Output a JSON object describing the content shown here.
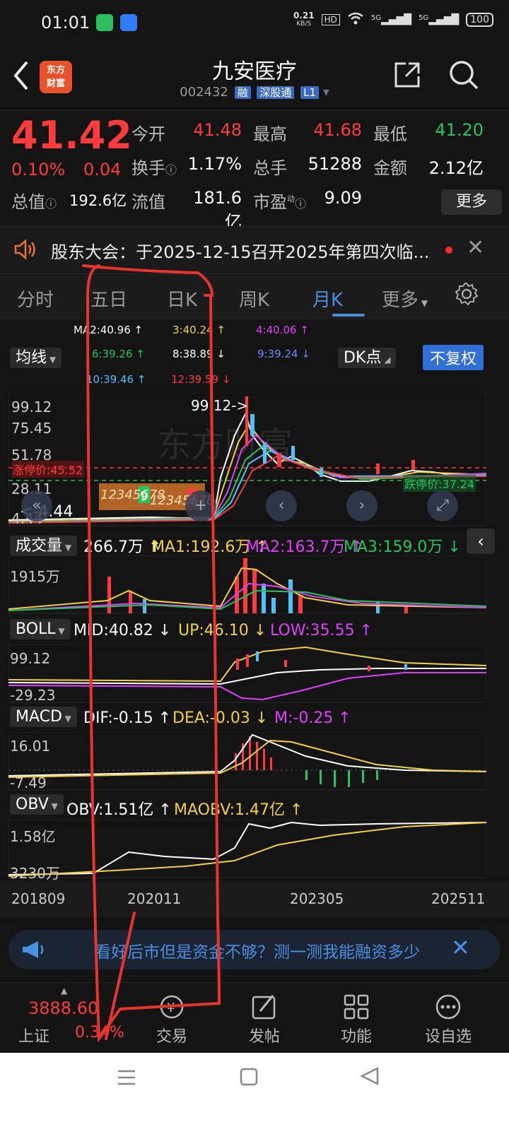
{
  "status": {
    "time": "01:01",
    "net_speed": "0.21",
    "net_unit": "KB/S",
    "hd": "HD",
    "sig1": "5G",
    "sig2": "5G",
    "battery": "100"
  },
  "header": {
    "logo_line1": "东方",
    "logo_line2": "财富",
    "title": "九安医疗",
    "code": "002432",
    "tag_margin": "融",
    "tag_connect": "深股通",
    "tag_level": "L1"
  },
  "quote": {
    "price": "41.42",
    "change_pct": "0.10%",
    "change": "0.04",
    "open_label": "今开",
    "open": "41.48",
    "high_label": "最高",
    "high": "41.68",
    "low_label": "最低",
    "low": "41.20",
    "turnover_label": "换手",
    "turnover": "1.17%",
    "volume_label": "总手",
    "volume": "51288",
    "amount_label": "金额",
    "amount": "2.12亿",
    "mktcap_label": "总值",
    "mktcap": "192.6亿",
    "float_label": "流值",
    "float": "181.6亿",
    "pe_label": "市盈",
    "pe_sup": "动",
    "pe": "9.09",
    "more": "更多"
  },
  "notice": {
    "text": "股东大会：于2025-12-15召开2025年第四次临..."
  },
  "tabs": [
    {
      "label": "分时"
    },
    {
      "label": "五日"
    },
    {
      "label": "日K"
    },
    {
      "label": "周K"
    },
    {
      "label": "月K"
    },
    {
      "label": "更多"
    }
  ],
  "ma": {
    "ma2": "MA2:40.96 ↑",
    "ma3": "3:40.24 ↑",
    "ma4": "4:40.06 ↑",
    "ma6": "6:39.26 ↑",
    "ma8": "8:38.89 ↓",
    "ma9": "9:39.24 ↓",
    "ma10": "10:39.46 ↑",
    "ma12": "12:39.59 ↓",
    "line_btn": "均线",
    "dk_btn": "DK点",
    "adjust_btn": "不复权"
  },
  "kline": {
    "y_top": "99.12",
    "y_2": "75.45",
    "y_3": "51.78",
    "y_4": "28.11",
    "y_5": "4.44",
    "high_mark": "99.12->",
    "low_mark": "<-4.44",
    "limit_up": "涨停价:45.52",
    "limit_down": "跌停价:37.24",
    "signals": "12345678",
    "sig9a": "9",
    "signals2": "12345678",
    "sig9b": "9"
  },
  "volume": {
    "label": "成交量",
    "val": "266.7万 ↑",
    "ma1": "MA1:192.6万 ↑",
    "ma2": "MA2:163.7万 ↑",
    "ma3": "MA3:159.0万 ↓",
    "y_top": "1915万"
  },
  "boll": {
    "label": "BOLL",
    "mid": "MID:40.82 ↓",
    "up": "UP:46.10 ↓",
    "low": "LOW:35.55 ↑",
    "y_top": "99.12",
    "y_bot": "-29.23"
  },
  "macd": {
    "label": "MACD",
    "dif": "DIF:-0.15 ↑",
    "dea": "DEA:-0.03 ↓",
    "m": "M:-0.25 ↑",
    "y_top": "16.01",
    "y_bot": "-7.49"
  },
  "obv": {
    "label": "OBV",
    "obv": "OBV:1.51亿 ↑",
    "maobv": "MAOBV:1.47亿 ↑",
    "y_top": "1.58亿",
    "y_bot": "3230万"
  },
  "xaxis": [
    "201809",
    "202011",
    "202305",
    "202511"
  ],
  "banner": {
    "text": "看好后市但是资金不够？测一测我能融资多少"
  },
  "bottom": {
    "index_value": "3888.60",
    "index_name": "上证",
    "index_pct": "0.34%",
    "trade": "交易",
    "post": "发帖",
    "func": "功能",
    "watch": "设自选"
  },
  "colors": {
    "up": "#ff3b3b",
    "down": "#22c55e",
    "accent": "#4a90e2",
    "annotation": "#e8342c"
  }
}
